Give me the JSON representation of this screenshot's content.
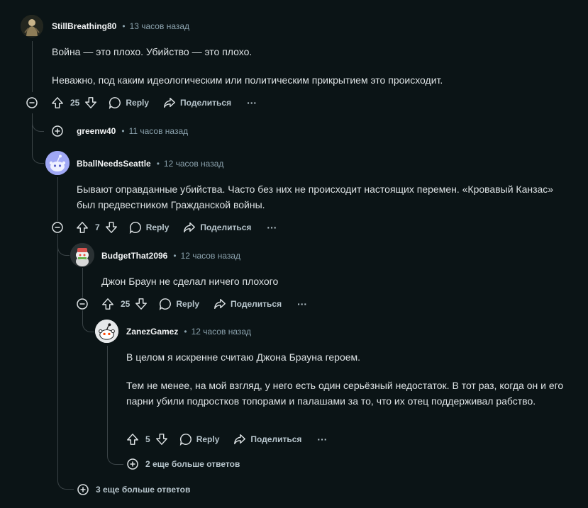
{
  "comments": [
    {
      "user": "StillBreathing80",
      "time": "13 часов назад",
      "paragraphs": [
        "Война — это плохо. Убийство — это плохо.",
        "Неважно, под каким идеологическим или политическим прикрытием это происходит."
      ],
      "votes": "25"
    },
    {
      "user": "greenw40",
      "time": "11 часов назад"
    },
    {
      "user": "BballNeedsSeattle",
      "time": "12 часов назад",
      "paragraphs": [
        "Бывают оправданные убийства. Часто без них не происходит настоящих перемен. «Кровавый Канзас» был предвестником Гражданской войны."
      ],
      "votes": "7"
    },
    {
      "user": "BudgetThat2096",
      "time": "12 часов назад",
      "paragraphs": [
        "Джон Браун не сделал ничего плохого"
      ],
      "votes": "25"
    },
    {
      "user": "ZanezGamez",
      "time": "12 часов назад",
      "paragraphs": [
        "В целом я искренне считаю Джона Брауна героем.",
        "Тем не менее, на мой взгляд, у него есть один серьёзный недостаток. В тот раз, когда он и его парни убили подростков топорами и палашами за то, что их отец поддерживал рабство."
      ],
      "votes": "5"
    }
  ],
  "labels": {
    "reply": "Reply",
    "share": "Поделиться",
    "more": "···",
    "dot": "•"
  },
  "more_replies": {
    "inner": "2 еще больше ответов",
    "outer": "3 еще больше ответов"
  },
  "colors": {
    "background": "#0b1416",
    "text": "#dde2e4",
    "muted": "#8ba2ad",
    "thread_line": "#3b4447"
  }
}
